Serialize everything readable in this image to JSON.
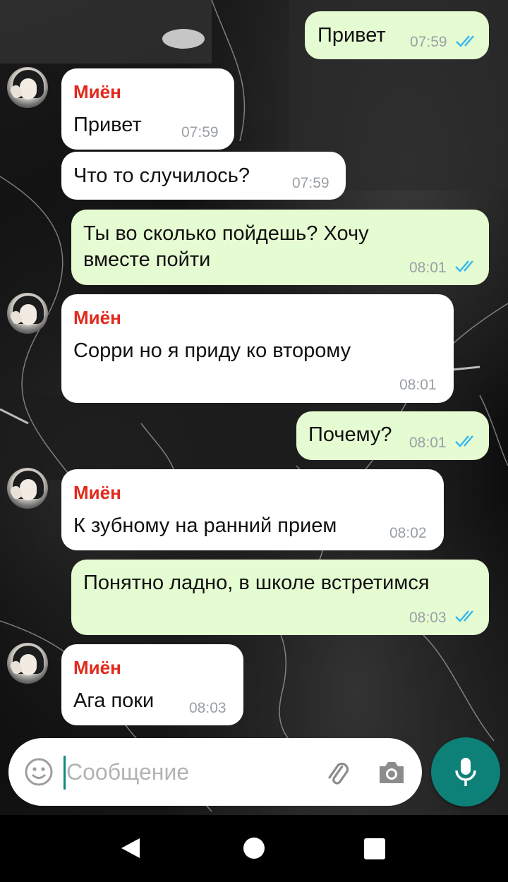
{
  "contact": {
    "name": "Миён"
  },
  "messages": [
    {
      "direction": "out",
      "text": "Привет",
      "time": "07:59"
    },
    {
      "direction": "in",
      "sender": "Миён",
      "text": "Привет",
      "time": "07:59"
    },
    {
      "direction": "in",
      "text": "Что то случилось?",
      "time": "07:59"
    },
    {
      "direction": "out",
      "text_line1": "Ты во сколько пойдешь? Хочу",
      "text_line2": "вместе пойти",
      "time": "08:01"
    },
    {
      "direction": "in",
      "sender": "Миён",
      "text": "Сорри но я приду ко второму",
      "time": "08:01"
    },
    {
      "direction": "out",
      "text": "Почему?",
      "time": "08:01"
    },
    {
      "direction": "in",
      "sender": "Миён",
      "text": "К зубному на ранний прием",
      "time": "08:02"
    },
    {
      "direction": "out",
      "text": "Понятно ладно, в школе встретимся",
      "time": "08:03"
    },
    {
      "direction": "in",
      "sender": "Миён",
      "text": "Ага поки",
      "time": "08:03"
    }
  ],
  "composer": {
    "placeholder": "Сообщение"
  },
  "icons": {
    "emoji": "emoji-icon",
    "attach": "paperclip-icon",
    "camera": "camera-icon",
    "mic": "microphone-icon",
    "read_receipt": "double-check-icon"
  },
  "colors": {
    "incoming_bubble": "#ffffff",
    "outgoing_bubble": "#e5fbd1",
    "sender_name": "#e02a1d",
    "read_tick": "#34b7f1",
    "mic_button": "#0d8178"
  }
}
